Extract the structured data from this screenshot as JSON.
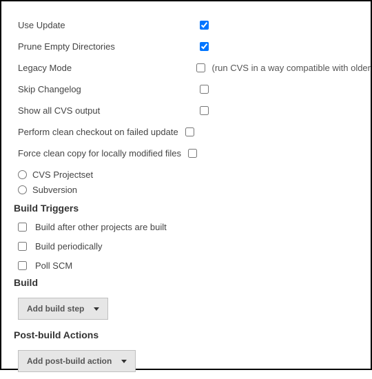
{
  "cvs_options": [
    {
      "label": "Use Update",
      "checked": true,
      "hint": "",
      "fixed": true
    },
    {
      "label": "Prune Empty Directories",
      "checked": true,
      "hint": "",
      "fixed": true
    },
    {
      "label": "Legacy Mode",
      "checked": false,
      "hint": "(run CVS in a way compatible with older",
      "fixed": true
    },
    {
      "label": "Skip Changelog",
      "checked": false,
      "hint": "",
      "fixed": true
    },
    {
      "label": "Show all CVS output",
      "checked": false,
      "hint": "",
      "fixed": true
    },
    {
      "label": "Perform clean checkout on failed update",
      "checked": false,
      "hint": "",
      "fixed": false
    },
    {
      "label": "Force clean copy for locally modified files",
      "checked": false,
      "hint": "",
      "fixed": false
    }
  ],
  "scm_radios": [
    {
      "label": "CVS Projectset",
      "checked": false
    },
    {
      "label": "Subversion",
      "checked": false
    }
  ],
  "sections": {
    "build_triggers": {
      "heading": "Build Triggers",
      "items": [
        {
          "label": "Build after other projects are built",
          "checked": false
        },
        {
          "label": "Build periodically",
          "checked": false
        },
        {
          "label": "Poll SCM",
          "checked": false
        }
      ]
    },
    "build": {
      "heading": "Build",
      "button": "Add build step"
    },
    "post_build": {
      "heading": "Post-build Actions",
      "button": "Add post-build action"
    }
  }
}
